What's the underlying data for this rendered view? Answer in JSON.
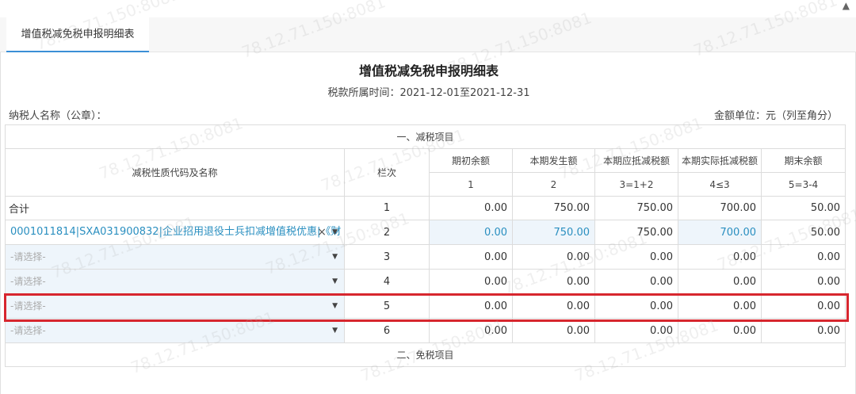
{
  "tab": {
    "label": "增值税减免税申报明细表"
  },
  "report": {
    "title": "增值税减免税申报明细表",
    "period": "税款所属时间：2021-12-01至2021-12-31",
    "taxpayer_label": "纳税人名称（公章）：",
    "unit_label": "金额单位：元（列至角分）"
  },
  "section1": {
    "title": "一、减税项目"
  },
  "section2": {
    "title": "二、免税项目"
  },
  "columns": {
    "name": "减税性质代码及名称",
    "row_no": "栏次",
    "c1": "期初余额",
    "c2": "本期发生额",
    "c3": "本期应抵减税额",
    "c4": "本期实际抵减税额",
    "c5": "期末余额"
  },
  "column_numbers": {
    "c1": "1",
    "c2": "2",
    "c3": "3=1+2",
    "c4": "4≤3",
    "c5": "5=3-4"
  },
  "rows": [
    {
      "name": "合计",
      "no": "1",
      "c1": "0.00",
      "c2": "750.00",
      "c3": "750.00",
      "c4": "700.00",
      "c5": "50.00"
    },
    {
      "name": "0001011814|SXA031900832|企业招用退役士兵扣减增值税优惠|《财",
      "no": "2",
      "c1": "0.00",
      "c2": "750.00",
      "c3": "750.00",
      "c4": "700.00",
      "c5": "50.00"
    },
    {
      "name": "-请选择-",
      "no": "3",
      "c1": "0.00",
      "c2": "0.00",
      "c3": "0.00",
      "c4": "0.00",
      "c5": "0.00"
    },
    {
      "name": "-请选择-",
      "no": "4",
      "c1": "0.00",
      "c2": "0.00",
      "c3": "0.00",
      "c4": "0.00",
      "c5": "0.00"
    },
    {
      "name": "-请选择-",
      "no": "5",
      "c1": "0.00",
      "c2": "0.00",
      "c3": "0.00",
      "c4": "0.00",
      "c5": "0.00"
    },
    {
      "name": "-请选择-",
      "no": "6",
      "c1": "0.00",
      "c2": "0.00",
      "c3": "0.00",
      "c4": "0.00",
      "c5": "0.00"
    }
  ],
  "icons": {
    "dropdown": "▼",
    "clear": "×",
    "corner": "▲"
  },
  "watermark": "78.12.71.150:8081",
  "colors": {
    "accent": "#3b8fd6",
    "highlight": "#d7262e",
    "value_blue": "#2a8fc0"
  }
}
